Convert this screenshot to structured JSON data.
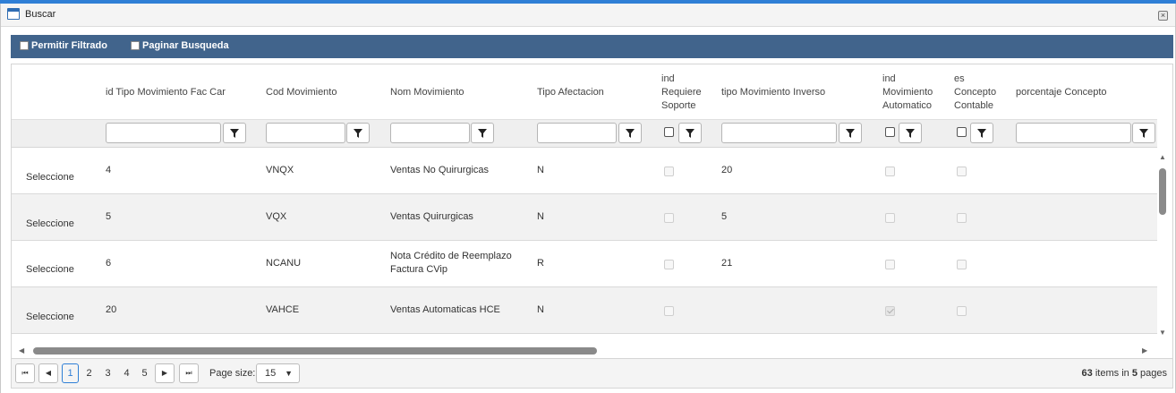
{
  "window": {
    "title": "Buscar",
    "close_glyph": "×"
  },
  "options": {
    "permitir_filtrado": "Permitir Filtrado",
    "paginar_busqueda": "Paginar Busqueda"
  },
  "columns": {
    "id_tipo": "id Tipo Movimiento Fac Car",
    "cod_mov": "Cod Movimiento",
    "nom_mov": "Nom Movimiento",
    "tipo_afect": "Tipo Afectacion",
    "ind_req_soporte": [
      "ind",
      "Requiere",
      "Soporte"
    ],
    "tipo_mov_inverso": "tipo Movimiento Inverso",
    "ind_mov_auto": [
      "ind",
      "Movimiento",
      "Automatico"
    ],
    "es_concepto": [
      "es",
      "Concepto",
      "Contable"
    ],
    "porcentaje": "porcentaje Concepto"
  },
  "rows": [
    {
      "select": "Seleccione",
      "id": "4",
      "cod": "VNQX",
      "nom": [
        "Ventas No Quirurgicas"
      ],
      "afect": "N",
      "req_soporte": false,
      "inverso": "20",
      "auto": false,
      "concepto": false
    },
    {
      "select": "Seleccione",
      "id": "5",
      "cod": "VQX",
      "nom": [
        "Ventas Quirurgicas"
      ],
      "afect": "N",
      "req_soporte": false,
      "inverso": "5",
      "auto": false,
      "concepto": false
    },
    {
      "select": "Seleccione",
      "id": "6",
      "cod": "NCANU",
      "nom": [
        "Nota Crédito de Reemplazo",
        "Factura CVip"
      ],
      "afect": "R",
      "req_soporte": false,
      "inverso": "21",
      "auto": false,
      "concepto": false
    },
    {
      "select": "Seleccione",
      "id": "20",
      "cod": "VAHCE",
      "nom": [
        "Ventas Automaticas HCE"
      ],
      "afect": "N",
      "req_soporte": false,
      "inverso": "",
      "auto": true,
      "concepto": false
    }
  ],
  "pager": {
    "first": "⏮",
    "prev": "◀",
    "next": "▶",
    "last": "⏭",
    "pages": [
      "1",
      "2",
      "3",
      "4",
      "5"
    ],
    "current_page": "1",
    "page_size_label": "Page size:",
    "page_size_value": "15",
    "total_items": "63",
    "items_in": "items in",
    "total_pages": "5",
    "pages_word": "pages"
  },
  "icons": {
    "window": "window-icon",
    "close": "close-icon",
    "filter": "filter-icon"
  },
  "colors": {
    "option_bar": "#41648c",
    "accent": "#2f7fd6"
  }
}
